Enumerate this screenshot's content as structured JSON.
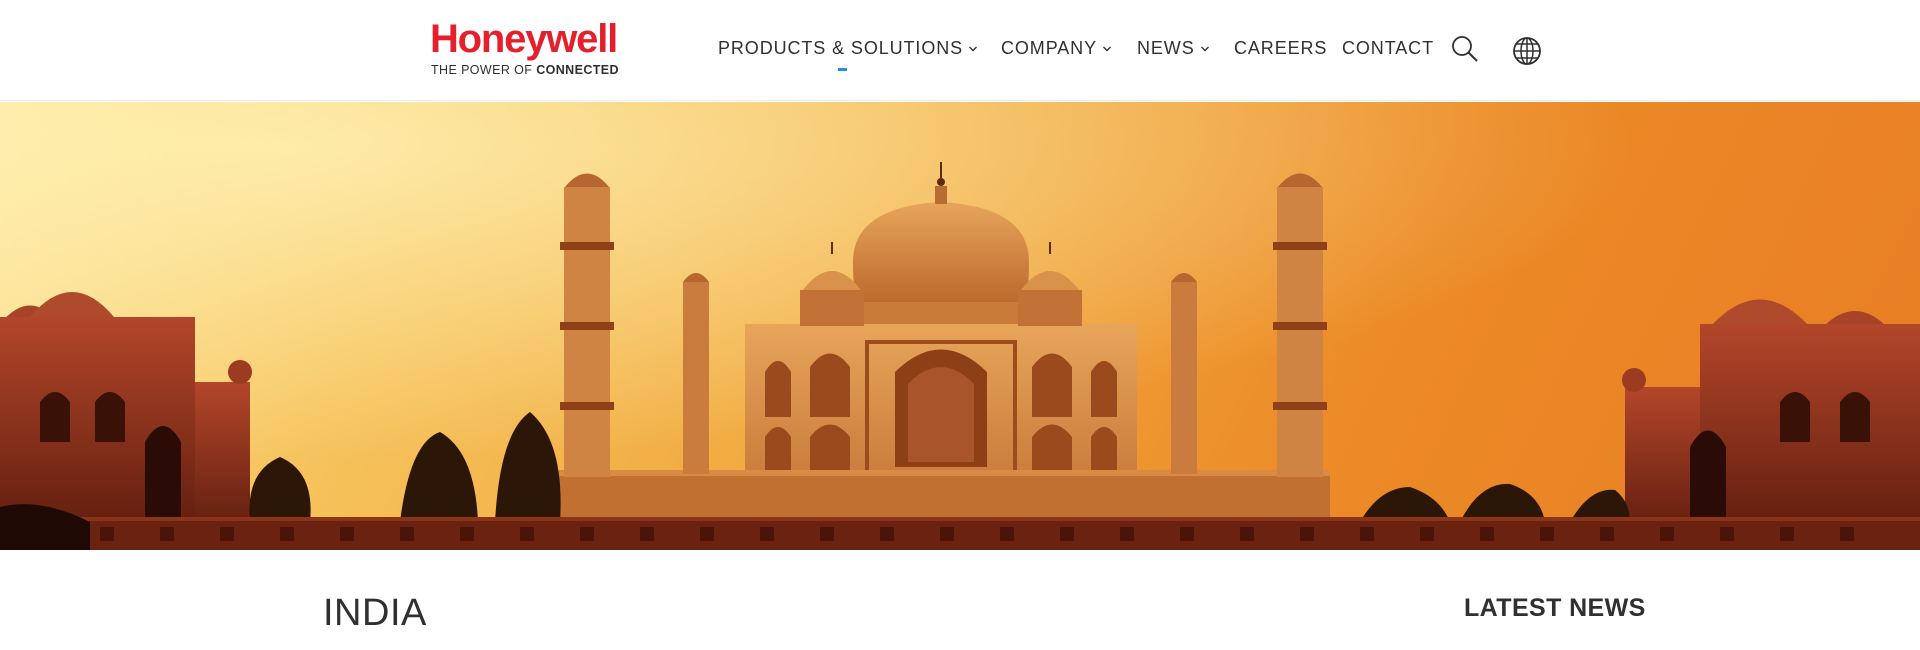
{
  "brand": {
    "name": "Honeywell",
    "tagline_prefix": "THE POWER OF",
    "tagline_bold": "CONNECTED",
    "color": "#e4202d"
  },
  "nav": {
    "items": [
      {
        "label": "PRODUCTS & SOLUTIONS",
        "has_dropdown": true,
        "active": true
      },
      {
        "label": "COMPANY",
        "has_dropdown": true,
        "active": false
      },
      {
        "label": "NEWS",
        "has_dropdown": true,
        "active": false
      },
      {
        "label": "CAREERS",
        "has_dropdown": false,
        "active": false
      },
      {
        "label": "CONTACT",
        "has_dropdown": false,
        "active": false
      }
    ],
    "icons": {
      "search": "search-icon",
      "language": "globe-icon"
    },
    "active_color": "#1792e5"
  },
  "hero": {
    "image": "taj-mahal-sunset",
    "colors": {
      "sky_light": "#fde59a",
      "sky_dark": "#e87d24",
      "stone": "#d88a3f",
      "shadow": "#7a2a12"
    }
  },
  "main": {
    "title": "INDIA"
  },
  "sidebar": {
    "heading": "LATEST NEWS"
  }
}
